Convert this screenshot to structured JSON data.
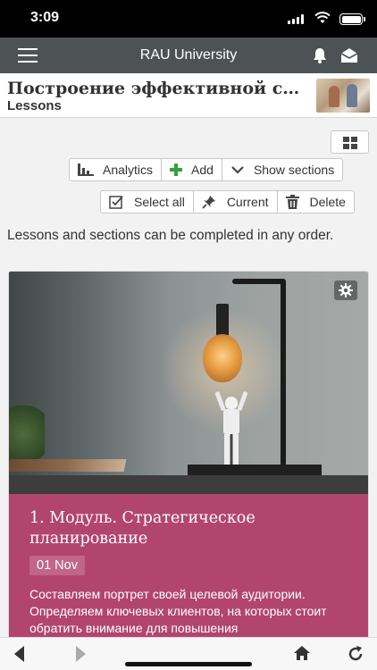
{
  "status": {
    "time": "3:09"
  },
  "appbar": {
    "title": "RAU University"
  },
  "course": {
    "title": "Построение эффективной системы продаж",
    "subtitle": "Lessons"
  },
  "toolbar": {
    "analytics": "Analytics",
    "add": "Add",
    "show_sections": "Show sections",
    "select_all": "Select all",
    "current": "Current",
    "delete": "Delete"
  },
  "description": "Lessons and sections can be completed in any order.",
  "module": {
    "title": "1. Модуль. Стратегическое планирование",
    "date": "01 Nov",
    "text": "Составляем портрет своей целевой аудитории. Определяем ключевых клиентов, на которых стоит обратить внимание для повышения"
  },
  "colors": {
    "appbar": "#4d5354",
    "card_panel": "#b2456e",
    "add_icon": "#3aa03a"
  },
  "icons": [
    "menu-icon",
    "bell-icon",
    "envelope-open-icon",
    "grid-view-icon",
    "bar-chart-icon",
    "plus-icon",
    "chevron-down-icon",
    "checkbox-icon",
    "pin-icon",
    "trash-icon",
    "gear-icon",
    "back-arrow-icon",
    "forward-arrow-icon",
    "home-icon",
    "reload-icon"
  ]
}
